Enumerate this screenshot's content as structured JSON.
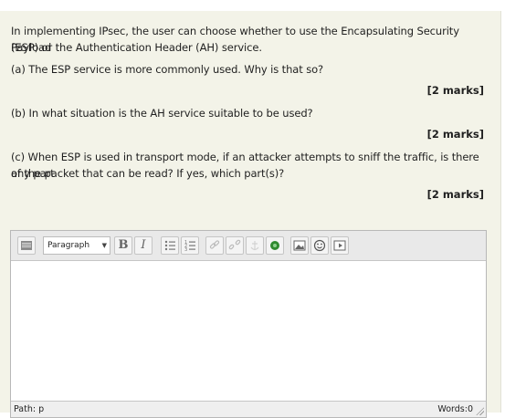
{
  "question": {
    "intro_line1": "In implementing IPsec, the user can choose whether to use the Encapsulating Security Payload",
    "intro_line2": "(ESP) or the Authentication Header (AH) service.",
    "part_a": "(a) The ESP service is more commonly used. Why is that so?",
    "part_a_marks": "[2 marks]",
    "part_b": "(b) In what situation is the AH service suitable to be used?",
    "part_b_marks": "[2 marks]",
    "part_c_line1": "(c) When ESP is used in transport mode, if an attacker attempts to sniff the traffic, is there any part",
    "part_c_line2": "of the packet that can be read? If yes, which part(s)?",
    "part_c_marks": "[2 marks]"
  },
  "editor": {
    "format_select_value": "Paragraph",
    "bold_label": "B",
    "italic_label": "I",
    "path_label": "Path: p",
    "word_count": "Words:0",
    "icons": [
      "toolbar-toggle-icon",
      "bullet-list-icon",
      "numbered-list-icon",
      "link-icon",
      "unlink-icon",
      "anchor-icon",
      "embed-media-icon",
      "insert-image-icon",
      "emoticon-icon",
      "insert-media-icon",
      "resize-grip-icon"
    ],
    "answer_value": ""
  }
}
